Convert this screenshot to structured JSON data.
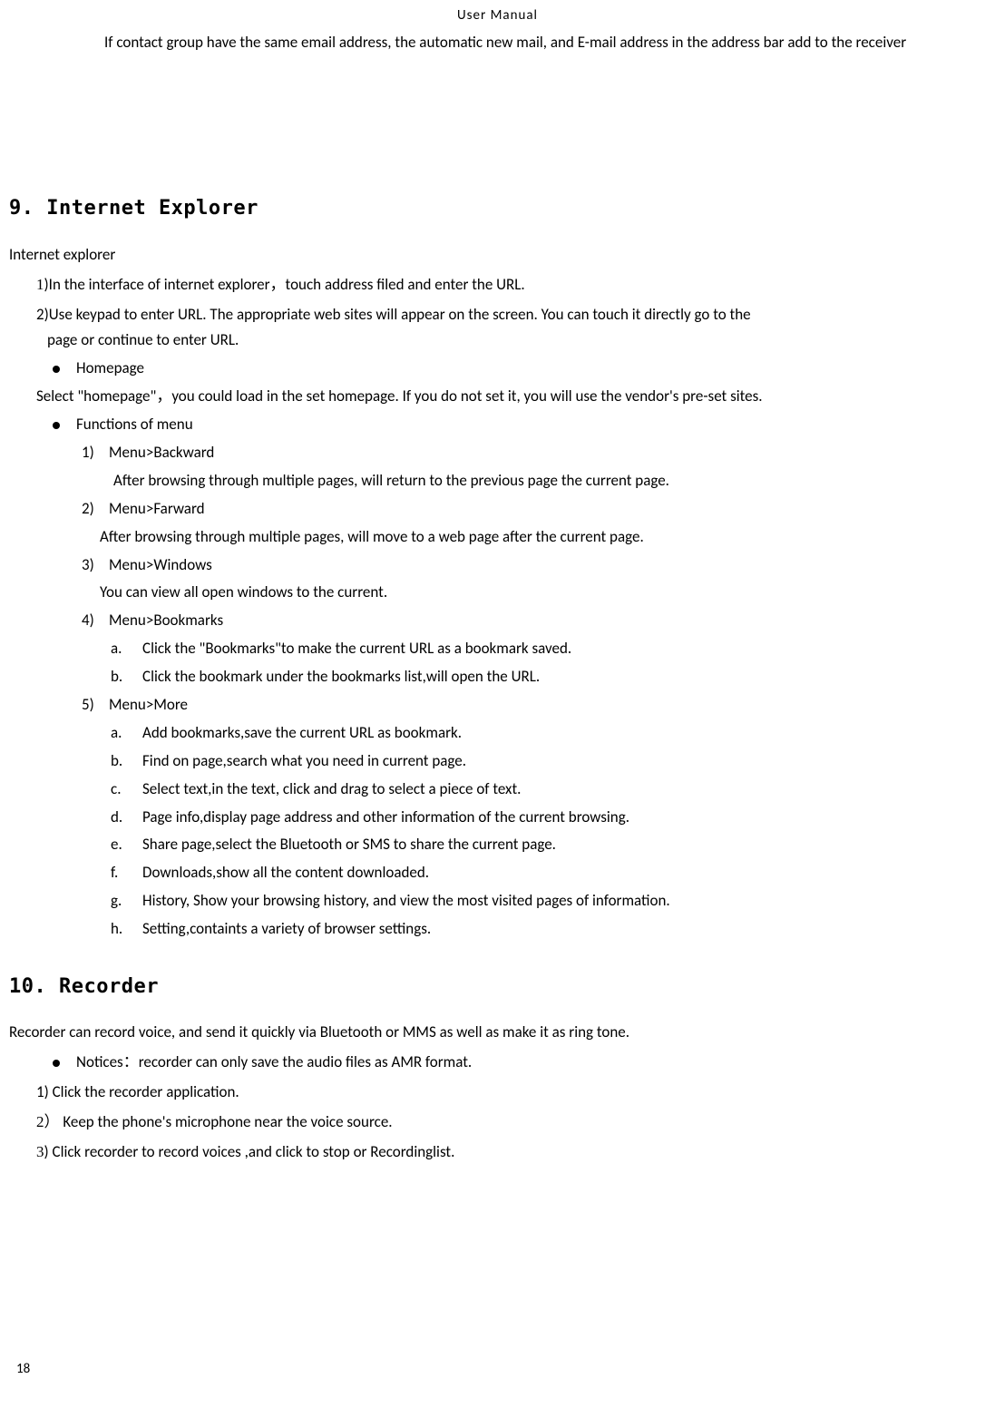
{
  "header": "User    Manual",
  "intro": "If contact group have the same email address, the automatic new mail, and E-mail address in the address bar add to the receiver",
  "section9": {
    "heading": "9. Internet Explorer",
    "sub1": "Internet explorer",
    "p1": "1)In the interface of internet explorer，touch address filed and enter the URL.",
    "p2a": "2)Use keypad to enter URL. The appropriate web sites will appear on the screen. You can touch it directly go to the",
    "p2b": "page or continue to enter URL.",
    "bullet1": "Homepage",
    "sel": "Select  \"homepage\"，you could load in the set homepage. If you do not set it, you will use the vendor's pre-set sites.",
    "bullet2": "Functions of menu",
    "menu": [
      {
        "n": "1)",
        "t": "Menu>Backward",
        "after": "After browsing through multiple pages, will return to the previous page the current page."
      },
      {
        "n": "2)",
        "t": "Menu>Farward",
        "after": "After browsing through multiple pages, will move to a web page after the current page."
      },
      {
        "n": "3)",
        "t": "Menu>Windows",
        "after": "You can view all open windows to the current."
      },
      {
        "n": "4)",
        "t": "Menu>Bookmarks"
      },
      {
        "n": "5)",
        "t": "Menu>More"
      }
    ],
    "bm": [
      {
        "l": "a.",
        "t": "Click the \"Bookmarks\"to make the current URL as a bookmark saved."
      },
      {
        "l": "b.",
        "t": "Click the bookmark under the bookmarks list,will open the URL."
      }
    ],
    "more": [
      {
        "l": "a.",
        "t": "Add bookmarks,save the current URL as bookmark."
      },
      {
        "l": "b.",
        "t": "Find on page,search what you need in current page."
      },
      {
        "l": "c.",
        "t": "Select text,in the text, click and drag to select a piece of text."
      },
      {
        "l": "d.",
        "t": "Page info,display page address and other information of the current browsing."
      },
      {
        "l": "e.",
        "t": "Share page,select the Bluetooth or SMS to share the current page."
      },
      {
        "l": "f.",
        "t": "Downloads,show all the content downloaded."
      },
      {
        "l": "g.",
        "t": "History, Show your browsing history, and view the most visited pages of information."
      },
      {
        "l": "h.",
        "t": "Setting,containts a variety of browser settings."
      }
    ]
  },
  "section10": {
    "heading": "10. Recorder",
    "p1": "Recorder can record voice, and send it quickly via Bluetooth or MMS as well as make it as ring tone.",
    "bullet": "Notices：recorder can only save the audio files as AMR format.",
    "s1": "1) Click the recorder application.",
    "s2n": "2）",
    "s2t": "Keep the phone's microphone near the voice source.",
    "s3n": "3",
    "s3t": ") Click recorder to record voices ,and click to stop or Recordinglist."
  },
  "pageNumber": "18"
}
